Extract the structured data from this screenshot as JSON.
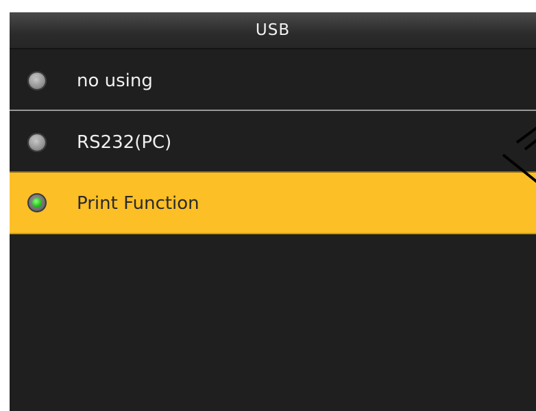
{
  "header": {
    "title": "USB"
  },
  "options": [
    {
      "label": "no using",
      "selected": false
    },
    {
      "label": "RS232(PC)",
      "selected": false
    },
    {
      "label": "Print Function",
      "selected": true
    }
  ],
  "colors": {
    "background": "#1f1f1f",
    "selected_row": "#fcbf26",
    "selected_indicator": "#23c21a"
  }
}
